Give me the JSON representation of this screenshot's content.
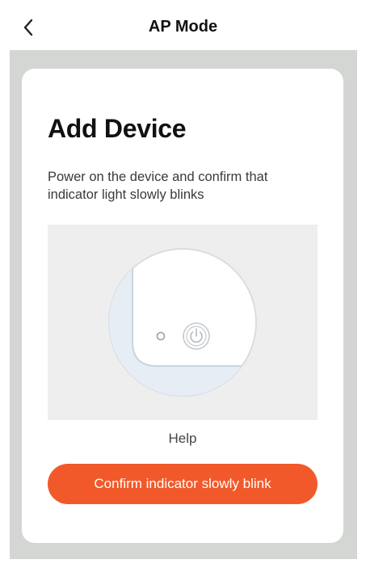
{
  "header": {
    "title": "AP Mode",
    "back_icon": "chevron-left-icon"
  },
  "card": {
    "title": "Add Device",
    "description": "Power on the device and confirm that indicator light slowly blinks",
    "illustration": {
      "icons": [
        "indicator-light-icon",
        "power-icon"
      ]
    },
    "help_label": "Help",
    "confirm_label": "Confirm indicator slowly blink"
  },
  "colors": {
    "accent": "#f2592a",
    "backdrop": "#d4d6d3",
    "illustration_bg": "#eeeeee",
    "device_panel": "#e6edf5"
  }
}
